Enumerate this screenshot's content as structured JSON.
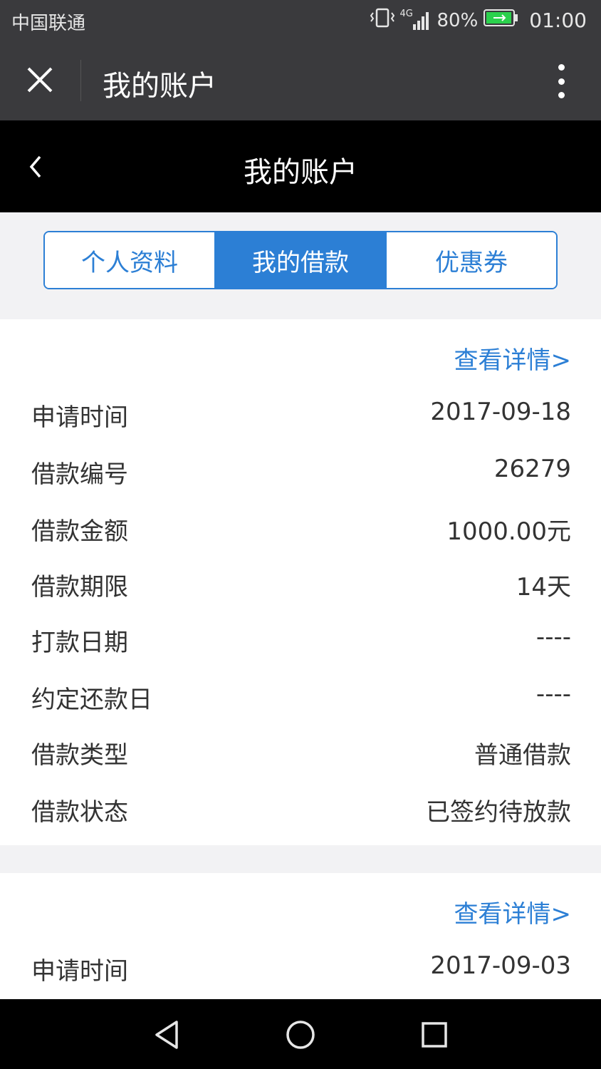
{
  "status_bar": {
    "carrier": "中国联通",
    "network": "4G",
    "battery": "80%",
    "time": "01:00",
    "icons": [
      "vibrate-icon",
      "signal-icon",
      "battery-icon"
    ]
  },
  "app_bar": {
    "title": "我的账户",
    "close_icon": "close-icon",
    "more_icon": "more-vertical-icon"
  },
  "page_header": {
    "title": "我的账户",
    "back_icon": "chevron-left-icon"
  },
  "tabs": [
    {
      "label": "个人资料",
      "active": false
    },
    {
      "label": "我的借款",
      "active": true
    },
    {
      "label": "优惠券",
      "active": false
    }
  ],
  "loans": [
    {
      "detail_link": "查看详情>",
      "fields": [
        {
          "label": "申请时间",
          "value": "2017-09-18"
        },
        {
          "label": "借款编号",
          "value": "26279"
        },
        {
          "label": "借款金额",
          "value": "1000.00元"
        },
        {
          "label": "借款期限",
          "value": "14天"
        },
        {
          "label": "打款日期",
          "value": "----"
        },
        {
          "label": "约定还款日",
          "value": "----"
        },
        {
          "label": "借款类型",
          "value": "普通借款"
        },
        {
          "label": "借款状态",
          "value": "已签约待放款"
        }
      ]
    },
    {
      "detail_link": "查看详情>",
      "fields": [
        {
          "label": "申请时间",
          "value": "2017-09-03"
        }
      ]
    }
  ],
  "nav_bar": {
    "icons": [
      "back-triangle-icon",
      "home-circle-icon",
      "recents-square-icon"
    ]
  },
  "colors": {
    "accent": "#2c7fd5",
    "app_bar": "#3a3a3d",
    "page_header": "#000000",
    "background": "#f2f2f4",
    "battery_green": "#2bd14d"
  }
}
